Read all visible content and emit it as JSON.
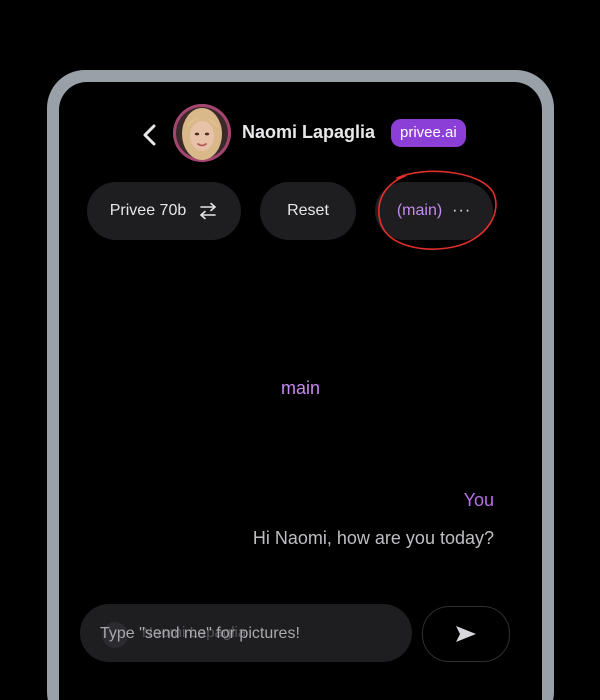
{
  "header": {
    "name": "Naomi Lapaglia",
    "badge": "privee.ai",
    "back_icon": "chevron-left-icon"
  },
  "controls": {
    "model_label": "Privee 70b",
    "model_icon": "swap-arrows-icon",
    "reset_label": "Reset",
    "branch_label": "(main)",
    "branch_menu": "···"
  },
  "chat": {
    "branch_name": "main",
    "messages": [
      {
        "sender": "You",
        "text": "Hi Naomi, how are you today?"
      }
    ]
  },
  "composer": {
    "placeholder": "Type \"send me\" for pictures!",
    "ghost_name": "Naomi Lapaglia",
    "send_icon": "send-arrow-icon"
  },
  "colors": {
    "accent": "#8b3fd6",
    "accent_text": "#c58af0",
    "frame": "#9aa0a8",
    "annotation": "#e0302a"
  }
}
